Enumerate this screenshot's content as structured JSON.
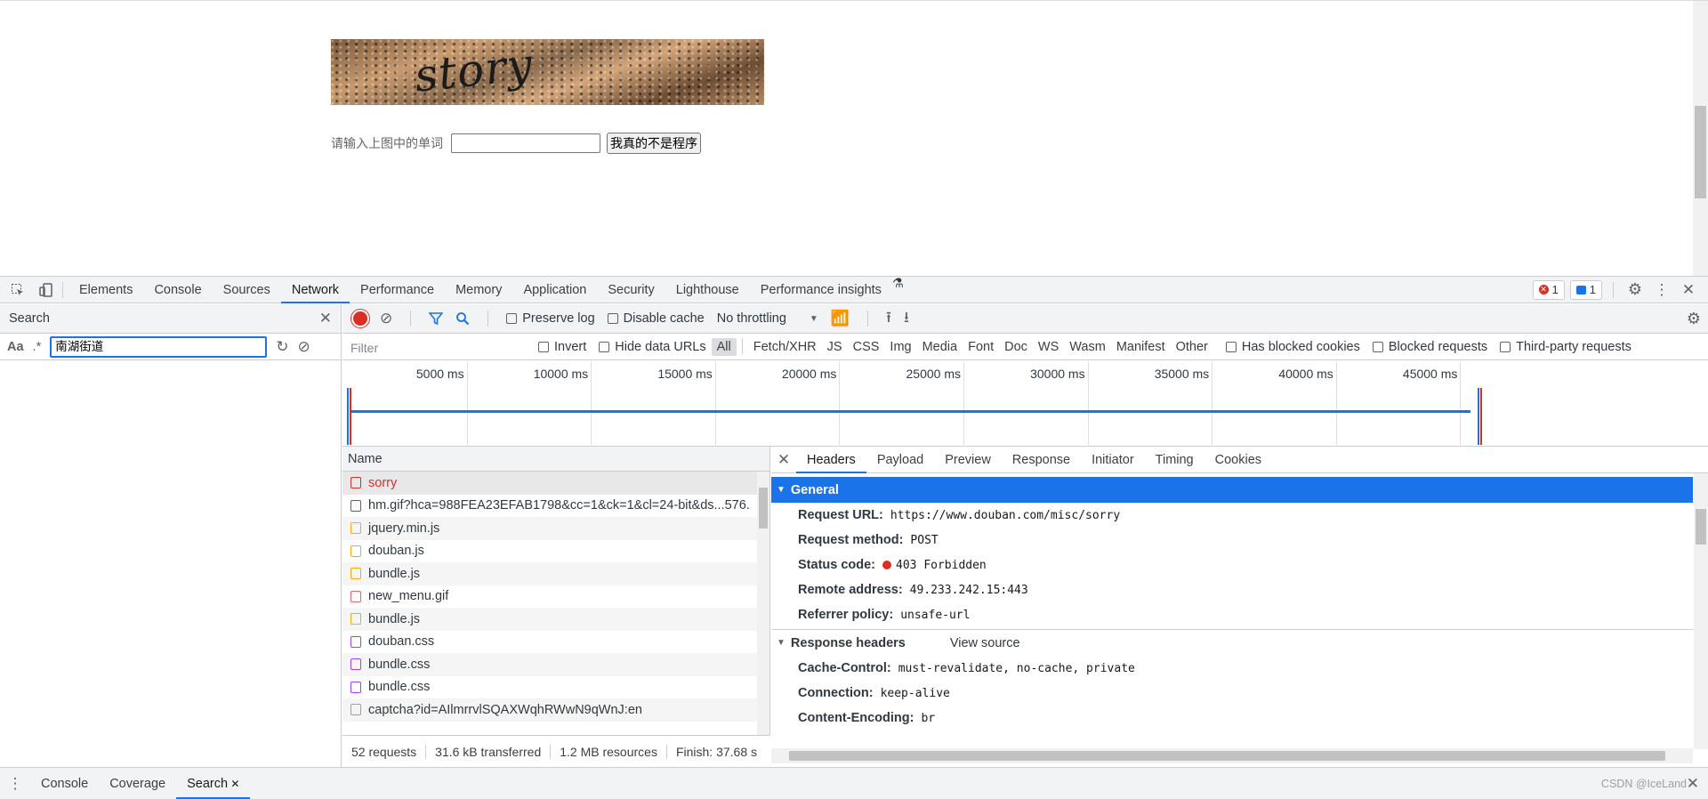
{
  "page": {
    "captcha_word": "story",
    "captcha_label": "请输入上图中的单词",
    "captcha_input_value": "",
    "submit_label": "我真的不是程序"
  },
  "devtools": {
    "tabs": [
      "Elements",
      "Console",
      "Sources",
      "Network",
      "Performance",
      "Memory",
      "Application",
      "Security",
      "Lighthouse",
      "Performance insights"
    ],
    "selected_tab": "Network",
    "error_count": "1",
    "message_count": "1"
  },
  "search": {
    "title": "Search",
    "case_label": "Aa",
    "regex_label": ".*",
    "query": "南湖街道"
  },
  "network": {
    "toolbar": {
      "preserve_log": "Preserve log",
      "disable_cache": "Disable cache",
      "throttling": "No throttling"
    },
    "filter": {
      "placeholder": "Filter",
      "invert": "Invert",
      "hide_data_urls": "Hide data URLs",
      "types": [
        "All",
        "Fetch/XHR",
        "JS",
        "CSS",
        "Img",
        "Media",
        "Font",
        "Doc",
        "WS",
        "Wasm",
        "Manifest",
        "Other"
      ],
      "has_blocked_cookies": "Has blocked cookies",
      "blocked_requests": "Blocked requests",
      "third_party": "Third-party requests"
    },
    "timeline_ticks": [
      "5000 ms",
      "10000 ms",
      "15000 ms",
      "20000 ms",
      "25000 ms",
      "30000 ms",
      "35000 ms",
      "40000 ms",
      "45000 ms"
    ],
    "requests_header": "Name",
    "requests": [
      {
        "name": "sorry",
        "kind": "doc"
      },
      {
        "name": "hm.gif?hca=988FEA23EFAB1798&cc=1&ck=1&cl=24-bit&ds...576.",
        "kind": "img"
      },
      {
        "name": "jquery.min.js",
        "kind": "js"
      },
      {
        "name": "douban.js",
        "kind": "js"
      },
      {
        "name": "bundle.js",
        "kind": "js"
      },
      {
        "name": "new_menu.gif",
        "kind": "gif"
      },
      {
        "name": "bundle.js",
        "kind": "js"
      },
      {
        "name": "douban.css",
        "kind": "css"
      },
      {
        "name": "bundle.css",
        "kind": "css"
      },
      {
        "name": "bundle.css",
        "kind": "css"
      },
      {
        "name": "captcha?id=AIlmrrvlSQAXWqhRWwN9qWnJ:en",
        "kind": "other"
      }
    ],
    "summary": {
      "requests": "52 requests",
      "transferred": "31.6 kB transferred",
      "resources": "1.2 MB resources",
      "finish": "Finish: 37.68 s"
    },
    "details": {
      "tabs": [
        "Headers",
        "Payload",
        "Preview",
        "Response",
        "Initiator",
        "Timing",
        "Cookies"
      ],
      "general_title": "General",
      "general": [
        {
          "k": "Request URL:",
          "v": "https://www.douban.com/misc/sorry"
        },
        {
          "k": "Request method:",
          "v": "POST"
        },
        {
          "k": "Status code:",
          "v": "403 Forbidden"
        },
        {
          "k": "Remote address:",
          "v": "49.233.242.15:443"
        },
        {
          "k": "Referrer policy:",
          "v": "unsafe-url"
        }
      ],
      "response_title": "Response headers",
      "view_source": "View source",
      "response": [
        {
          "k": "Cache-Control:",
          "v": "must-revalidate, no-cache, private"
        },
        {
          "k": "Connection:",
          "v": "keep-alive"
        },
        {
          "k": "Content-Encoding:",
          "v": "br"
        }
      ]
    }
  },
  "drawer": {
    "tabs": [
      "Console",
      "Coverage",
      "Search"
    ],
    "selected": "Search"
  },
  "watermark": "CSDN @IceLand",
  "colors": {
    "accent": "#1a73e8",
    "error": "#d93025",
    "record": "#d93025"
  }
}
